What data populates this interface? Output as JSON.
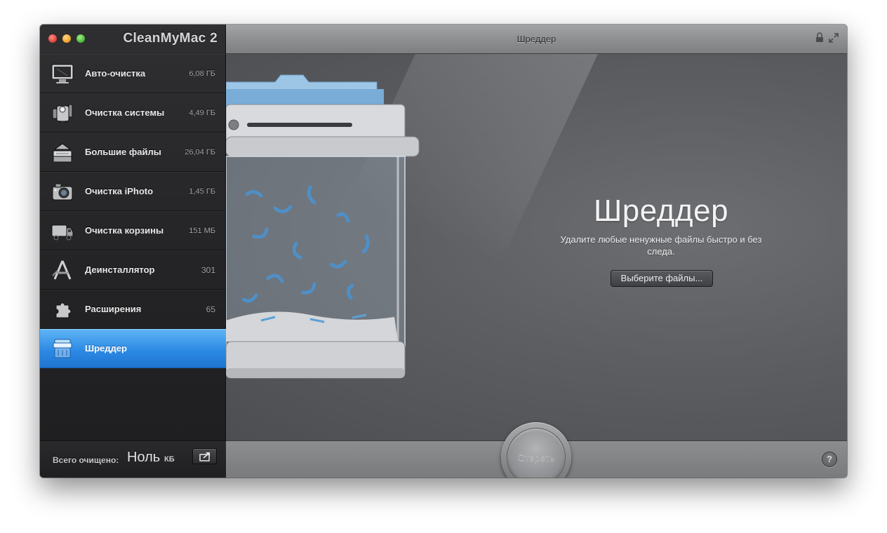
{
  "app": {
    "title": "CleanMyMac 2"
  },
  "window": {
    "title": "Шреддер"
  },
  "sidebar": {
    "items": [
      {
        "label": "Авто-очистка",
        "value": "6,08 ГБ",
        "icon": "monitor-icon"
      },
      {
        "label": "Очистка системы",
        "value": "4,49 ГБ",
        "icon": "system-cleanup-icon"
      },
      {
        "label": "Большие файлы",
        "value": "26,04 ГБ",
        "icon": "large-files-icon"
      },
      {
        "label": "Очистка iPhoto",
        "value": "1,45 ГБ",
        "icon": "camera-icon"
      },
      {
        "label": "Очистка корзины",
        "value": "151 МБ",
        "icon": "garbage-truck-icon"
      },
      {
        "label": "Деинсталлятор",
        "value": "301",
        "icon": "uninstaller-icon"
      },
      {
        "label": "Расширения",
        "value": "65",
        "icon": "puzzle-icon"
      },
      {
        "label": "Шреддер",
        "value": "",
        "icon": "shredder-icon",
        "active": true
      }
    ],
    "footer": {
      "label": "Всего очищено:",
      "value": "Ноль",
      "unit": "КБ"
    }
  },
  "main": {
    "hero_title": "Шреддер",
    "hero_subtitle": "Удалите любые ненужные файлы быстро и без следа.",
    "choose_button": "Выберите файлы...",
    "erase_button": "Стереть",
    "help_button": "?"
  },
  "colors": {
    "accent": "#2c8ae4",
    "sidebar_bg": "#232325",
    "content_bg": "#5d5e62"
  }
}
